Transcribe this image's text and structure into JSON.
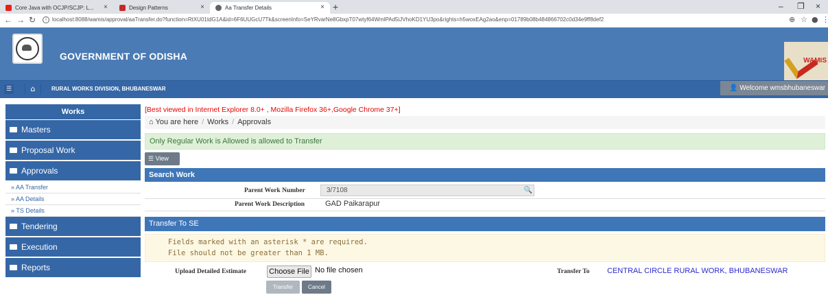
{
  "browser": {
    "tabs": [
      {
        "title": "Core Java with OCJP/SCJP: L...",
        "icon_color": "#e62117",
        "active": false
      },
      {
        "title": "Design Patterns",
        "icon_color": "#c62828",
        "active": false
      },
      {
        "title": "Aa Transfer Details",
        "icon_color": "#5f6368",
        "active": true
      }
    ],
    "url": "localhost:8088/wamis/approval/aaTransfer.do?function=RtXU01tdG1A&id=6F6UUGcU7Tk&screenInfo=SeYRvarNe8GbxpT07wtyf64WmlPAd5iJVhoKD1YU3po&rights=h5woxEAg2ao&enp=01789b08b484866702c0d34e9ff8def2"
  },
  "header": {
    "title": "GOVERNMENT OF ODISHA",
    "brand_logo_text": "WAMIS"
  },
  "navbar": {
    "division": "RURAL WORKS DIVISION, BHUBANESWAR",
    "welcome": "Welcome wmsbhubaneswar"
  },
  "sidebar": {
    "heading": "Works",
    "items": [
      {
        "label": "Masters"
      },
      {
        "label": "Proposal Work"
      },
      {
        "label": "Approvals"
      }
    ],
    "sub_items": [
      {
        "label": "» AA Transfer"
      },
      {
        "label": "» AA Details"
      },
      {
        "label": "» TS Details"
      }
    ],
    "items_after": [
      {
        "label": "Tendering"
      },
      {
        "label": "Execution"
      },
      {
        "label": "Reports"
      }
    ]
  },
  "main": {
    "best_viewed": "[Best viewed in Internet Explorer 8.0+ , Mozilla Firefox 36+,Google Chrome 37+]",
    "breadcrumb": {
      "prefix": "You are here",
      "items": [
        "Works",
        "Approvals"
      ]
    },
    "alert": "Only Regular Work is Allowed is allowed to Transfer",
    "view_button": "View",
    "search_panel": {
      "title": "Search Work",
      "parent_work_number_label": "Parent Work Number",
      "parent_work_number_value": "3/7108",
      "parent_work_description_label": "Parent Work Description",
      "parent_work_description_value": "GAD Paikarapur"
    },
    "transfer_panel": {
      "title": "Transfer To SE",
      "notice_line1": "Fields marked with an asterisk * are required.",
      "notice_line2": "File should not be greater than 1 MB.",
      "upload_label": "Upload Detailed Estimate",
      "choose_file": "Choose File",
      "no_file": "No file chosen",
      "transfer_to_label": "Transfer To",
      "transfer_to_value": "CENTRAL CIRCLE RURAL WORK, BHUBANESWAR",
      "transfer_button": "Transfer",
      "cancel_button": "Cancel"
    }
  }
}
